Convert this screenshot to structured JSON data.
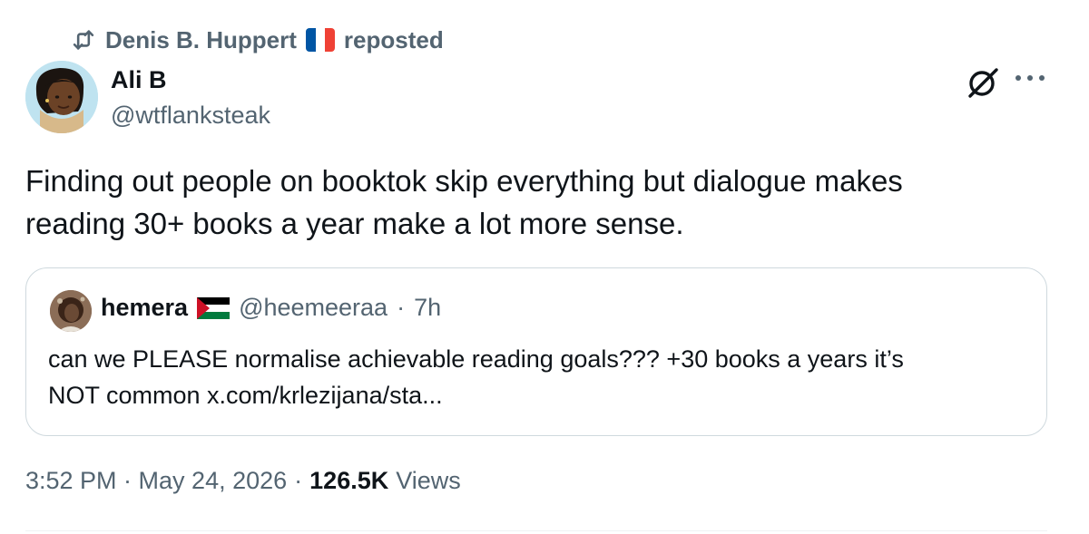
{
  "repost": {
    "user": "Denis B. Huppert",
    "flag_icon": "flag-france-icon",
    "label": "reposted"
  },
  "tweet": {
    "author_name": "Ali B",
    "author_handle": "@wtflanksteak",
    "text": "Finding out people on booktok skip everything but dialogue makes\nreading 30+ books a year make a lot more sense.",
    "timestamp": "3:52 PM · May 24, 2026",
    "separator": "·",
    "views_count": "126.5K",
    "views_label": "Views"
  },
  "quoted": {
    "name": "hemera",
    "flag_icon": "flag-palestine-icon",
    "handle": "@heemeeraa",
    "separator": "·",
    "time": "7h",
    "text": "can we PLEASE normalise achievable reading goals??? +30 books a years it’s\nNOT common x.com/krlezijana/sta..."
  },
  "icons": {
    "repost": "repost-icon",
    "grok": "grok-icon",
    "more": "more-options-icon"
  },
  "colors": {
    "primary_text": "#0f1419",
    "secondary_text": "#536471",
    "border": "#cfd9de"
  }
}
